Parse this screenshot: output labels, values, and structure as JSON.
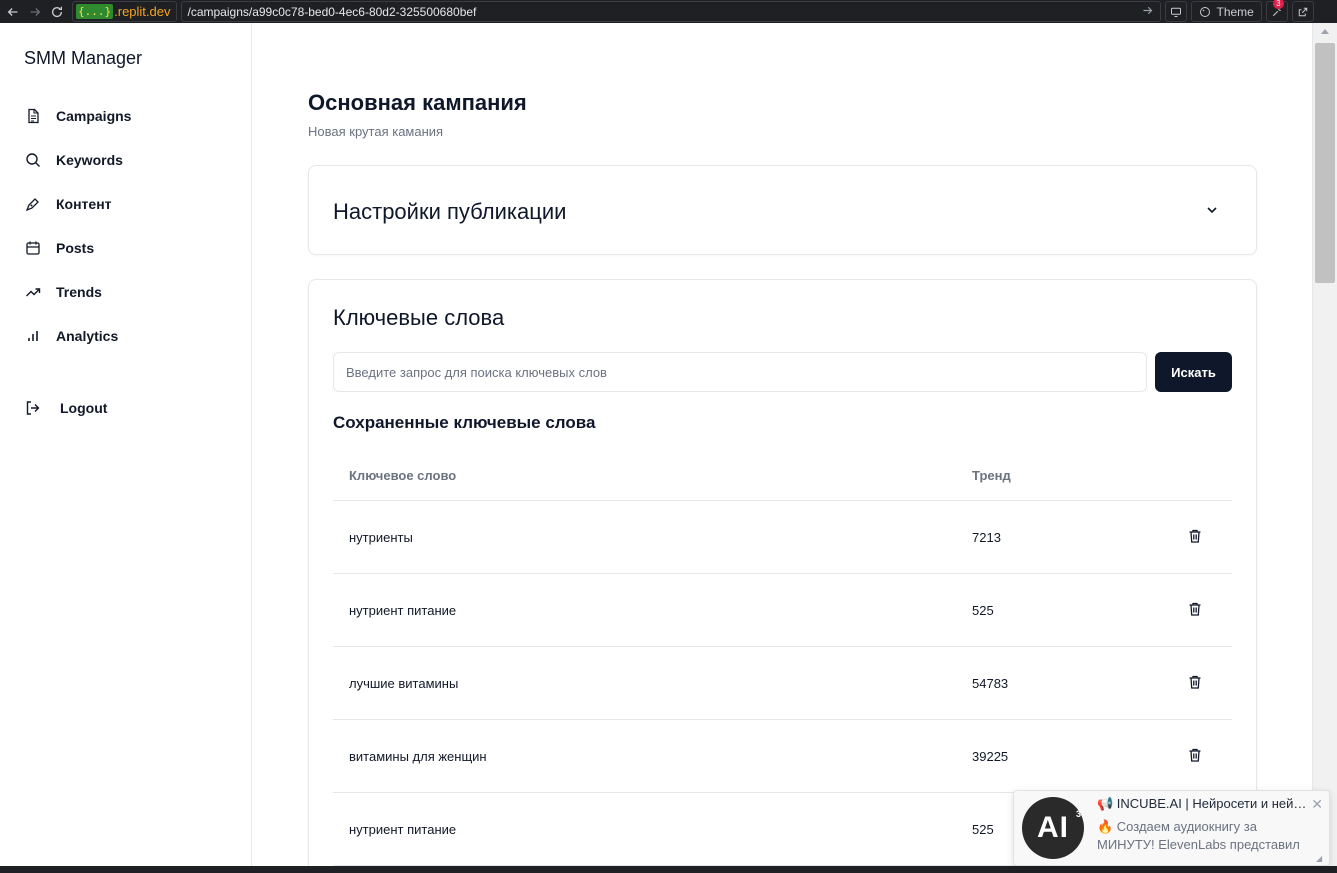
{
  "browser": {
    "domain_badge": "{...}",
    "domain": ".replit.dev",
    "url": "/campaigns/a99c0c78-bed0-4ec6-80d2-325500680bef",
    "theme_label": "Theme",
    "notif_count": "3"
  },
  "sidebar": {
    "brand": "SMM Manager",
    "items": [
      {
        "label": "Campaigns",
        "icon": "file-icon"
      },
      {
        "label": "Keywords",
        "icon": "search-icon"
      },
      {
        "label": "Контент",
        "icon": "pen-icon"
      },
      {
        "label": "Posts",
        "icon": "calendar-icon"
      },
      {
        "label": "Trends",
        "icon": "trending-icon"
      },
      {
        "label": "Analytics",
        "icon": "bar-chart-icon"
      }
    ],
    "logout": "Logout"
  },
  "campaign": {
    "title": "Основная кампания",
    "subtitle": "Новая крутая камания"
  },
  "settings_card": {
    "title": "Настройки публикации"
  },
  "keywords_card": {
    "title": "Ключевые слова",
    "search_placeholder": "Введите запрос для поиска ключевых слов",
    "search_value": "",
    "search_button": "Искать",
    "saved_title": "Сохраненные ключевые слова",
    "columns": [
      "Ключевое слово",
      "Тренд"
    ],
    "rows": [
      {
        "keyword": "нутриенты",
        "trend": "7213"
      },
      {
        "keyword": "нутриент питание",
        "trend": "525"
      },
      {
        "keyword": "лучшие витамины",
        "trend": "54783"
      },
      {
        "keyword": "витамины для женщин",
        "trend": "39225"
      },
      {
        "keyword": "нутриент питание",
        "trend": "525"
      }
    ]
  },
  "notification": {
    "title": "📢 INCUBE.AI | Нейросети и нейронки",
    "line2": "🔥 Создаем аудиокнигу за",
    "line3": "МИНУТУ! ElevenLabs представил",
    "logo_text": "AI",
    "logo_sup": "3"
  }
}
